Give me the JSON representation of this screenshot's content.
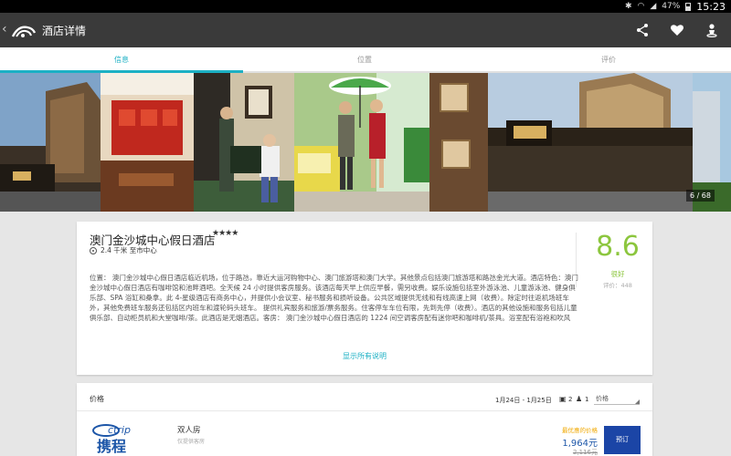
{
  "status_bar": {
    "battery": "47%",
    "time": "15:23"
  },
  "action_bar": {
    "title": "酒店详情"
  },
  "tabs": [
    {
      "label": "信息"
    },
    {
      "label": "位置"
    },
    {
      "label": "评价"
    }
  ],
  "gallery": {
    "counter": "6 / 68"
  },
  "hotel": {
    "name": "澳门金沙城中心假日酒店",
    "stars": "★★★★",
    "distance": "2.4 千米 至市中心",
    "score": "8.6",
    "score_label": "很好",
    "reviews": "评价：448",
    "description": "位置： 澳门金沙城中心假日酒店临近机场，位于路氹，靠近大运河购物中心、澳门旅游塔和澳门大学。其他景点包括澳门旅游塔和路氹金光大道。酒店特色：澳门金沙城中心假日酒店有咖啡馆和池畔酒吧。全天候 24 小时提供客房服务。该酒店每天早上供应早餐，需另收费。娱乐设施包括室外游泳池、儿童游泳池、健身俱乐部、SPA 浴缸和桑拿。此 4-星级酒店有商务中心，并提供小会议室、秘书服务和损听设备。公共区域提供无线和有线高速上网（收费）。除定时往返机场班车外，其他免费班车服务还包括区内班车和渡轮码头班车。 提供礼宾服务和旅游/票务服务。住客停车车位有限，先到先停（收费）。酒店的其他设施和服务包括儿童俱乐部、自动柜员机和大堂咖啡/茶。此酒店是无烟酒店。客房： 澳门金沙城中心假日酒店的 1224 间空调客房配有迷你吧和咖啡机/茶具。浴室配有浴袍和吹风",
    "show_all": "显示所有说明"
  },
  "price": {
    "title": "价格",
    "dates": "1月24日 - 1月25日",
    "rooms": "2",
    "guests": "1",
    "sort_label": "价格",
    "provider_logo_text": "ctrip",
    "provider_logo_cn": "携程",
    "room_name": "双人房",
    "room_sub": "仅提供客房",
    "best_label": "最优惠的价格",
    "best_price": "1,964元",
    "old_price": "2,116元",
    "book_label": "预订"
  },
  "colors": {
    "accent": "#1cb0c4",
    "score": "#8cc63e",
    "book": "#1b45a6",
    "best": "#f0a800",
    "price": "#1d56a8"
  },
  "icons": [
    "back-icon",
    "app-logo-icon",
    "share-icon",
    "heart-icon",
    "user-icon",
    "pin-icon",
    "room-icon",
    "guest-icon",
    "ctrip-logo"
  ]
}
